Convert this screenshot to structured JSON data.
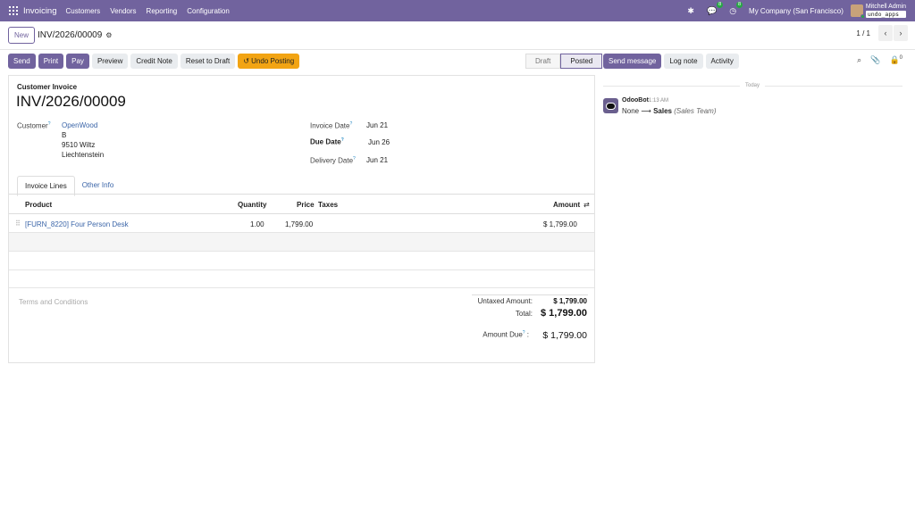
{
  "navbar": {
    "app_name": "Invoicing",
    "menus": [
      "Customers",
      "Vendors",
      "Reporting",
      "Configuration"
    ],
    "discuss_count": "8",
    "activity_count": "8",
    "company": "My Company (San Francisco)",
    "user_name": "Mitchell Admin",
    "db_name": "undo_apps"
  },
  "control": {
    "new_label": "New",
    "record_title": "INV/2026/00009",
    "pager": "1 / 1"
  },
  "actions": {
    "send": "Send",
    "print": "Print",
    "pay": "Pay",
    "preview": "Preview",
    "credit_note": "Credit Note",
    "reset_to_draft": "Reset to Draft",
    "undo_posting": "Undo Posting"
  },
  "status": {
    "draft": "Draft",
    "posted": "Posted",
    "current": "Posted"
  },
  "chatter": {
    "send_message": "Send message",
    "log_note": "Log note",
    "activity": "Activity",
    "followers_count": "0",
    "today_label": "Today",
    "message": {
      "author": "OdooBot",
      "time": "1:13 AM",
      "old_value": "None",
      "arrow": "⟶",
      "new_value": "Sales",
      "field": "(Sales Team)"
    }
  },
  "form": {
    "doc_type": "Customer Invoice",
    "number": "INV/2026/00009",
    "customer_label": "Customer",
    "customer_name": "OpenWood",
    "customer_address": [
      "B",
      "9510 Wiltz",
      "Liechtenstein"
    ],
    "invoice_date_label": "Invoice Date",
    "invoice_date": "Jun 21",
    "due_date_label": "Due Date",
    "due_date": "Jun 26",
    "delivery_date_label": "Delivery Date",
    "delivery_date": "Jun 21",
    "tabs": [
      "Invoice Lines",
      "Other Info"
    ],
    "columns": {
      "product": "Product",
      "quantity": "Quantity",
      "price": "Price",
      "taxes": "Taxes",
      "amount": "Amount"
    },
    "lines": [
      {
        "product": "[FURN_8220] Four Person Desk",
        "quantity": "1.00",
        "price": "1,799.00",
        "taxes": "",
        "amount": "$ 1,799.00"
      }
    ],
    "terms_placeholder": "Terms and Conditions",
    "untaxed_label": "Untaxed Amount:",
    "untaxed_value": "$ 1,799.00",
    "total_label": "Total:",
    "total_value": "$ 1,799.00",
    "amount_due_label": "Amount Due",
    "amount_due_value": "$ 1,799.00"
  },
  "colors": {
    "brand": "#71639e",
    "warning": "#f2a413",
    "link": "#3b65a8"
  }
}
